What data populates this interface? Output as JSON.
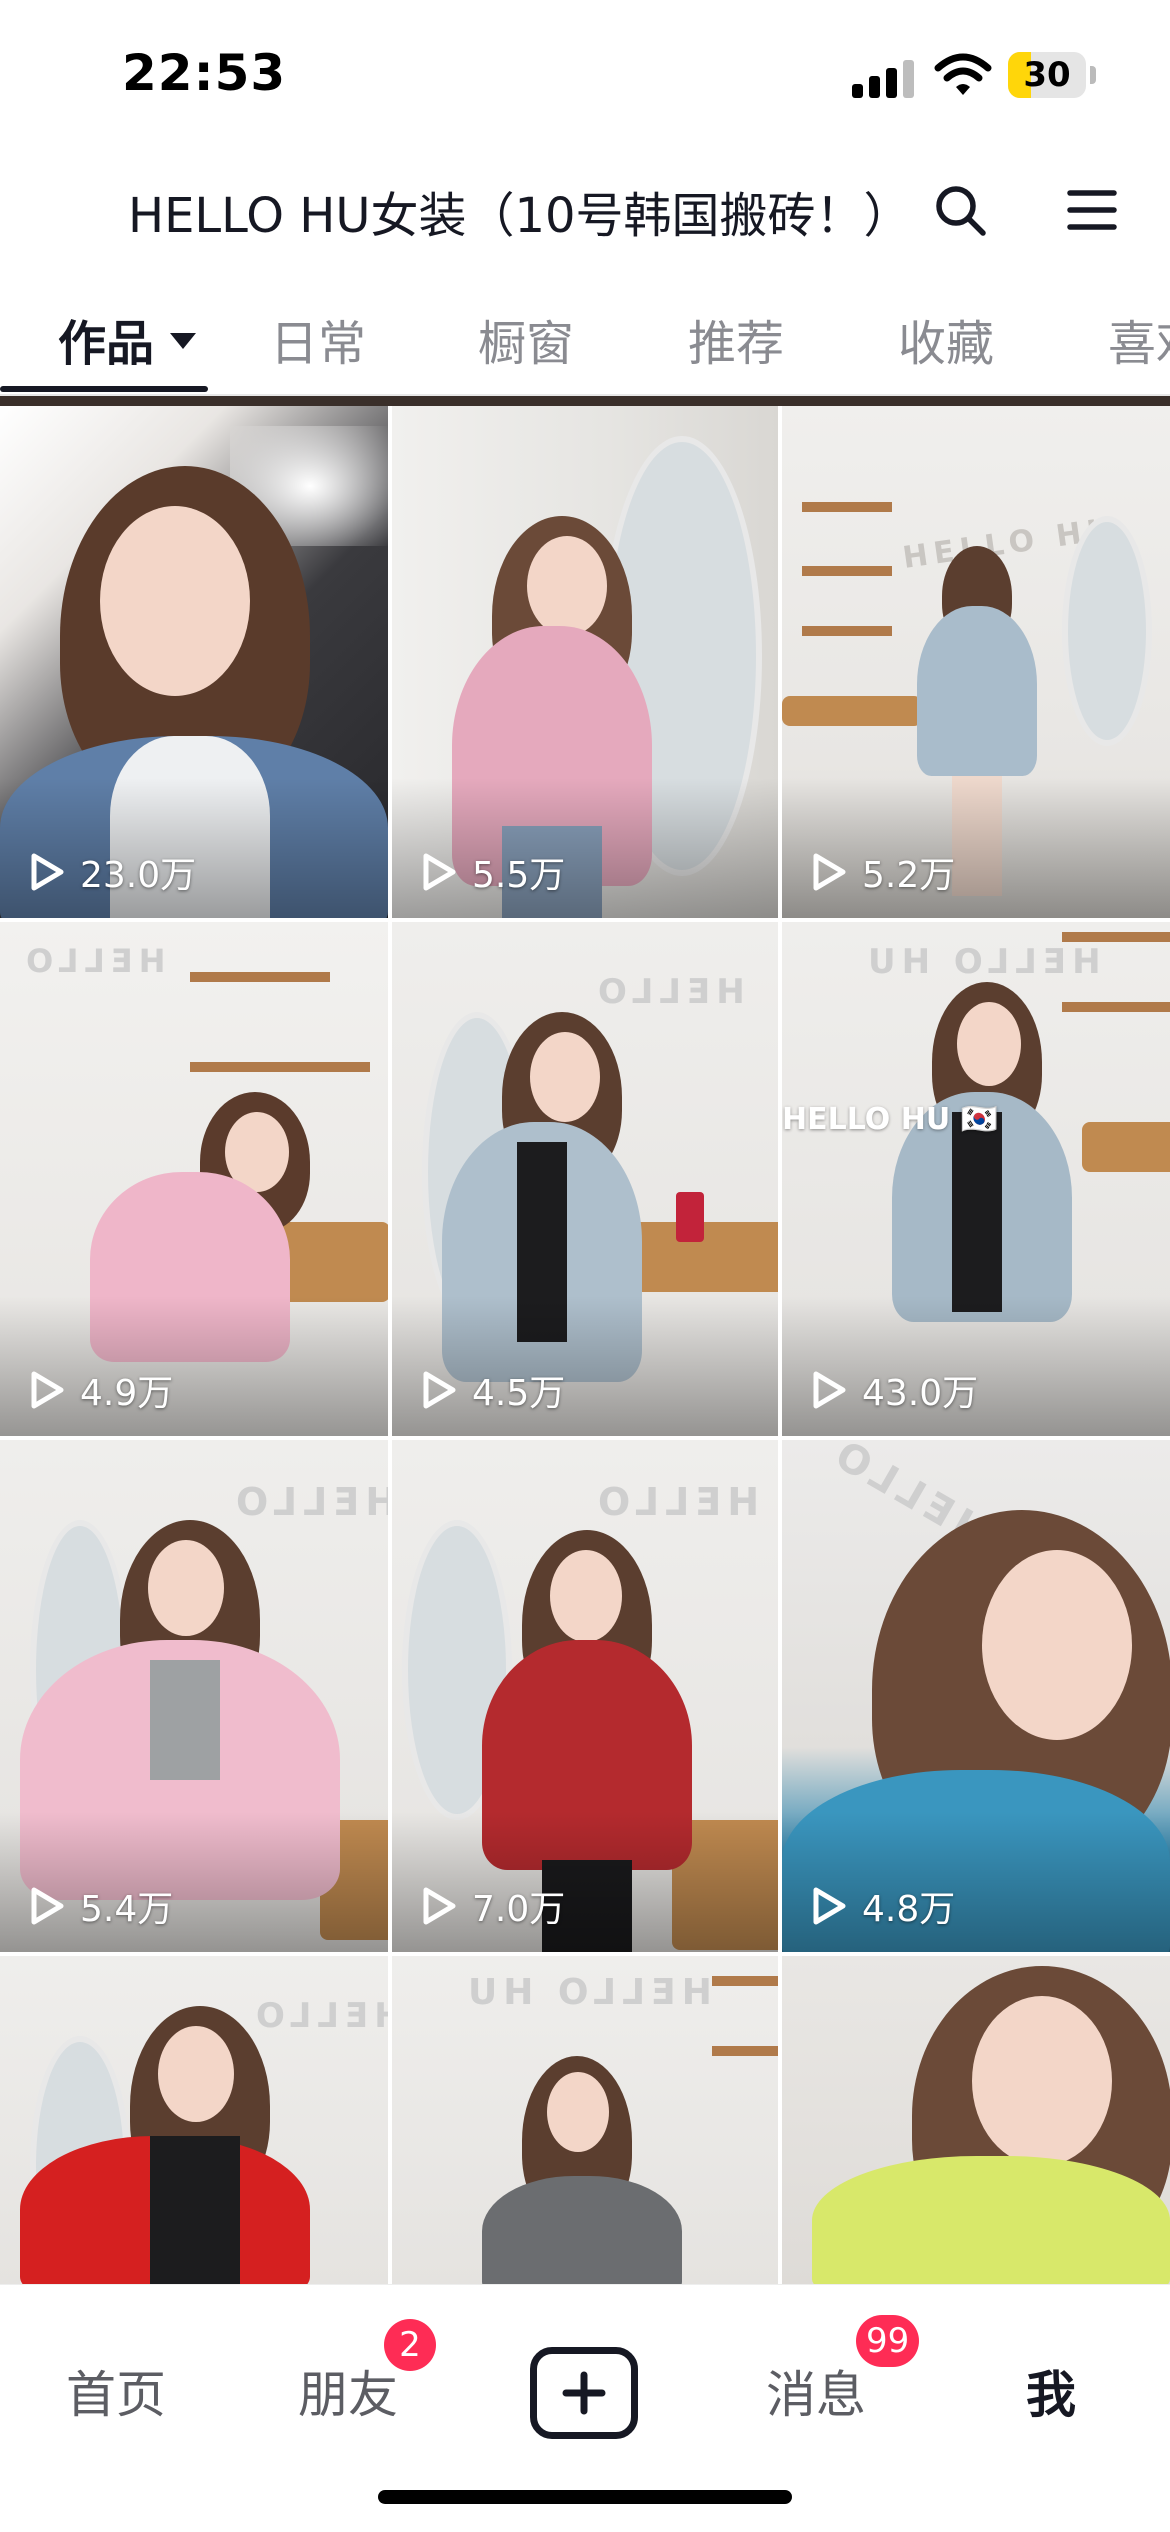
{
  "status_bar": {
    "time": "22:53",
    "battery_level": "30",
    "battery_fraction": 0.3,
    "signal_icon": "cellular-signal-icon",
    "wifi_icon": "wifi-icon"
  },
  "header": {
    "title": "HELLO HU女装（10号韩国搬砖！）",
    "search_icon": "search-icon",
    "menu_icon": "hamburger-menu-icon"
  },
  "tabs": [
    {
      "label": "作品",
      "active": true
    },
    {
      "label": "日常",
      "active": false
    },
    {
      "label": "橱窗",
      "active": false
    },
    {
      "label": "推荐",
      "active": false
    },
    {
      "label": "收藏",
      "active": false
    },
    {
      "label": "喜欢",
      "active": false
    }
  ],
  "videos": [
    {
      "views": "23.0万",
      "overlay": ""
    },
    {
      "views": "5.5万",
      "overlay": ""
    },
    {
      "views": "5.2万",
      "overlay": ""
    },
    {
      "views": "4.9万",
      "overlay": ""
    },
    {
      "views": "4.5万",
      "overlay": ""
    },
    {
      "views": "43.0万",
      "overlay": "HELLO HU 🇰🇷"
    },
    {
      "views": "5.4万",
      "overlay": ""
    },
    {
      "views": "7.0万",
      "overlay": ""
    },
    {
      "views": "4.8万",
      "overlay": ""
    },
    {
      "views": "",
      "overlay": ""
    },
    {
      "views": "",
      "overlay": ""
    },
    {
      "views": "",
      "overlay": ""
    }
  ],
  "wall_sign": "HELLO HU",
  "bottom_nav": {
    "home": "首页",
    "friends": "朋友",
    "friends_badge": "2",
    "create_icon": "plus-icon",
    "messages": "消息",
    "messages_badge": "99",
    "me": "我"
  },
  "colors": {
    "badge": "#fe2c55",
    "text_primary": "#161823",
    "text_secondary": "#8a8b91"
  }
}
